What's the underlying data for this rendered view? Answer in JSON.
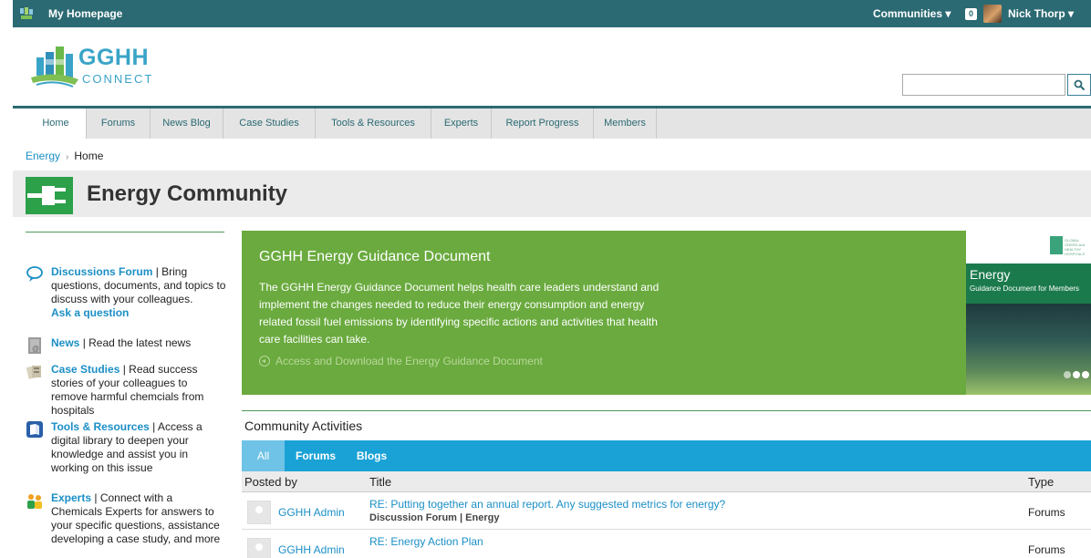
{
  "topbar": {
    "title": "My Homepage",
    "communities": "Communities ▾",
    "notifications": "0",
    "user": "Nick Thorp ▾"
  },
  "header": {
    "logo_text": "GGHH",
    "logo_sub": "CONNECT",
    "search": {
      "value": "",
      "placeholder": ""
    }
  },
  "nav": {
    "tabs": [
      {
        "label": "Home",
        "active": true
      },
      {
        "label": "Forums"
      },
      {
        "label": "News Blog"
      },
      {
        "label": "Case Studies"
      },
      {
        "label": "Tools & Resources"
      },
      {
        "label": "Experts"
      },
      {
        "label": "Report Progress"
      },
      {
        "label": "Members"
      }
    ]
  },
  "breadcrumb": {
    "parent": "Energy",
    "separator": "›",
    "current": "Home"
  },
  "community": {
    "title": "Energy Community"
  },
  "sidebar": {
    "items": [
      {
        "title": "Discussions Forum",
        "text": " | Bring questions, documents,  and topics to discuss with your colleagues.",
        "action": "Ask a question",
        "icon": "chat-bubble-icon"
      },
      {
        "title": "News",
        "text": " | Read the latest news",
        "icon": "news-icon"
      },
      {
        "title": "Case Studies",
        "text": " | Read success stories of your colleagues to remove harmful chemcials from hospitals",
        "icon": "case-studies-icon"
      },
      {
        "title": "Tools & Resources",
        "text": " | Access a digital library to deepen your knowledge and assist you in working on this issue",
        "icon": "book-icon"
      },
      {
        "title": "Experts",
        "text": " | Connect with a Chemicals Experts for answers to your specific questions, assistance developing a case study, and more",
        "icon": "people-icon"
      }
    ]
  },
  "feature": {
    "title": "GGHH Energy Guidance Document",
    "description": "The GGHH Energy Guidance Document helps health care leaders understand and implement the changes needed to reduce their energy consumption and energy related fossil fuel emissions by identifying specific actions and activities that health care facilities can take.",
    "link": "Access and Download the Energy Guidance Document",
    "cover_title": "Energy",
    "cover_sub": "Guidance Document for Members",
    "cover_logo": "GLOBAL GREEN and HEALTHY HOSPITALS",
    "slides_count": 3,
    "active_slide": 1
  },
  "activities": {
    "title": "Community Activities",
    "tabs": [
      {
        "label": "All",
        "active": true
      },
      {
        "label": "Forums"
      },
      {
        "label": "Blogs"
      }
    ],
    "columns": [
      "Posted by",
      "Title",
      "Type"
    ],
    "rows": [
      {
        "poster": "GGHH Admin",
        "title": "RE: Putting together an annual report. Any suggested metrics for energy?",
        "sub": "Discussion Forum | Energy",
        "type": "Forums"
      },
      {
        "poster": "GGHH Admin",
        "title": "RE: Energy Action Plan",
        "sub": "",
        "type": "Forums"
      }
    ]
  },
  "colors": {
    "topbar": "#2b6a73",
    "link": "#1b8fc6",
    "feature_green": "#6aaa3e",
    "tab_blue": "#1aa2d6",
    "energy_icon": "#2da04a"
  }
}
